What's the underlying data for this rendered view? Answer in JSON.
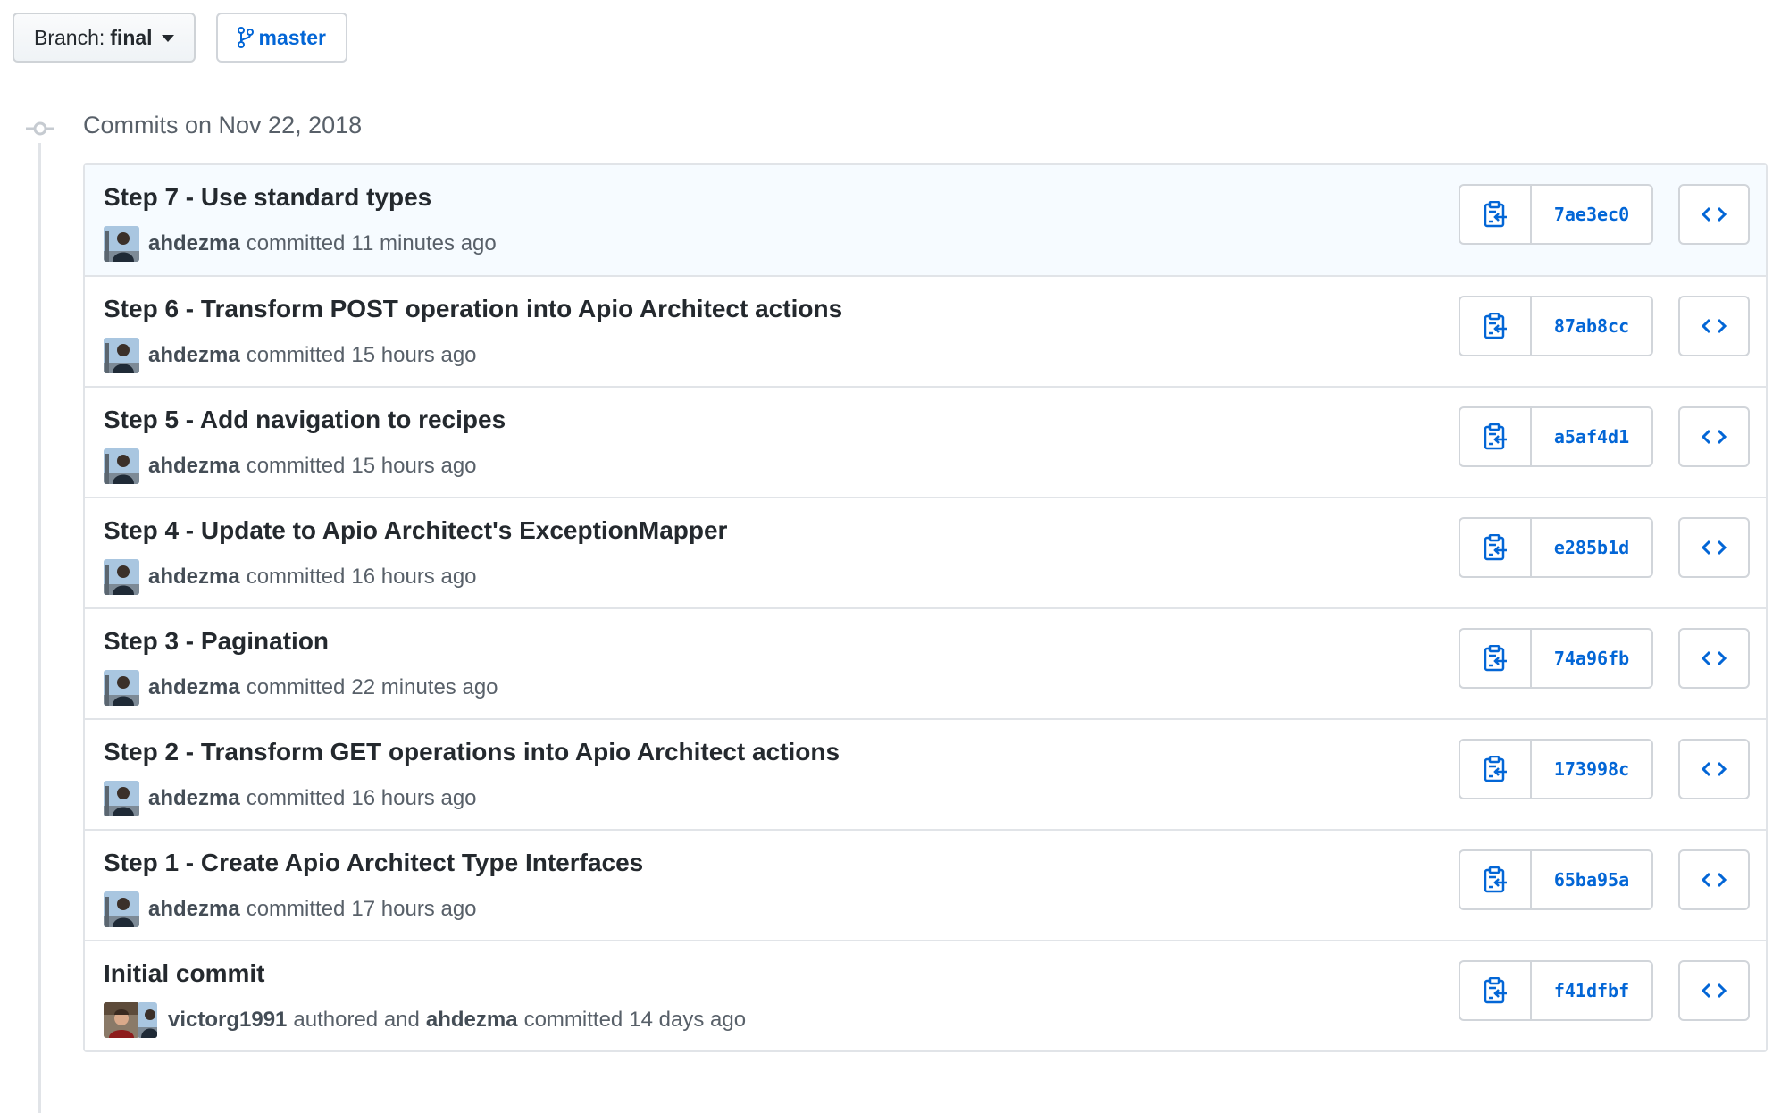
{
  "toolbar": {
    "branch_label": "Branch:",
    "branch_value": "final",
    "compare_branch": "master"
  },
  "group": {
    "title": "Commits on Nov 22, 2018"
  },
  "commits": [
    {
      "title": "Step 7 - Use standard types",
      "author": "ahdezma",
      "verb": "committed",
      "time": "11 minutes ago",
      "sha": "7ae3ec0"
    },
    {
      "title": "Step 6 - Transform POST operation into Apio Architect actions",
      "author": "ahdezma",
      "verb": "committed",
      "time": "15 hours ago",
      "sha": "87ab8cc"
    },
    {
      "title": "Step 5 - Add navigation to recipes",
      "author": "ahdezma",
      "verb": "committed",
      "time": "15 hours ago",
      "sha": "a5af4d1"
    },
    {
      "title": "Step 4 - Update to Apio Architect's ExceptionMapper",
      "author": "ahdezma",
      "verb": "committed",
      "time": "16 hours ago",
      "sha": "e285b1d"
    },
    {
      "title": "Step 3 - Pagination",
      "author": "ahdezma",
      "verb": "committed",
      "time": "22 minutes ago",
      "sha": "74a96fb"
    },
    {
      "title": "Step 2 - Transform GET operations into Apio Architect actions",
      "author": "ahdezma",
      "verb": "committed",
      "time": "16 hours ago",
      "sha": "173998c"
    },
    {
      "title": "Step 1 - Create Apio Architect Type Interfaces",
      "author": "ahdezma",
      "verb": "committed",
      "time": "17 hours ago",
      "sha": "65ba95a"
    },
    {
      "title": "Initial commit",
      "author": "victorg1991",
      "verb": "authored and",
      "coauthor": "ahdezma",
      "verb2": "committed",
      "time": "14 days ago",
      "sha": "f41dfbf"
    }
  ],
  "icons": {
    "branch": "git-branch-icon",
    "copy": "clipboard-icon",
    "browse": "code-icon",
    "timeline": "git-commit-icon"
  },
  "colors": {
    "link": "#0366d6",
    "text": "#24292e",
    "muted": "#586069",
    "border": "#e1e4e8",
    "highlight": "#f6fbff"
  }
}
